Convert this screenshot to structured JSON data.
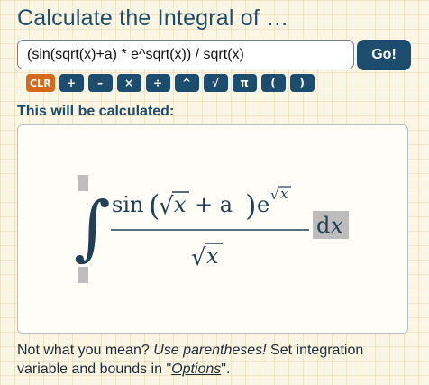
{
  "header": {
    "title": "Calculate the Integral of …"
  },
  "input": {
    "value": "(sin(sqrt(x)+a) * e^sqrt(x)) / sqrt(x)"
  },
  "go_button": {
    "label": "Go!"
  },
  "keypad": {
    "clear": "CLR",
    "plus": "+",
    "minus": "–",
    "times": "×",
    "divide": "÷",
    "power": "^",
    "sqrt": "√",
    "pi": "π",
    "open_paren": "(",
    "close_paren": ")"
  },
  "preview": {
    "heading": "This will be calculated:",
    "integral_sign": "∫",
    "numerator": {
      "sin": "sin",
      "open": "(",
      "sqrt_symbol": "√",
      "x": "x",
      "plus_a": "+ a",
      "close": ")",
      "e": "e",
      "exp_sqrt": "√",
      "exp_x": "x"
    },
    "denominator": {
      "sqrt_symbol": "√",
      "x": "x"
    },
    "differential": {
      "d": "d",
      "x": "x"
    }
  },
  "footer": {
    "part1": "Not what you mean? ",
    "emphasis": "Use parentheses!",
    "part2": " Set integration variable and bounds in \"",
    "options_link": "Options",
    "part3": "\"."
  },
  "colors": {
    "primary": "#1d4d6e",
    "clear_key": "#d66a1a",
    "background": "#fbf5e3",
    "placeholder_box": "#bdbdbd"
  }
}
